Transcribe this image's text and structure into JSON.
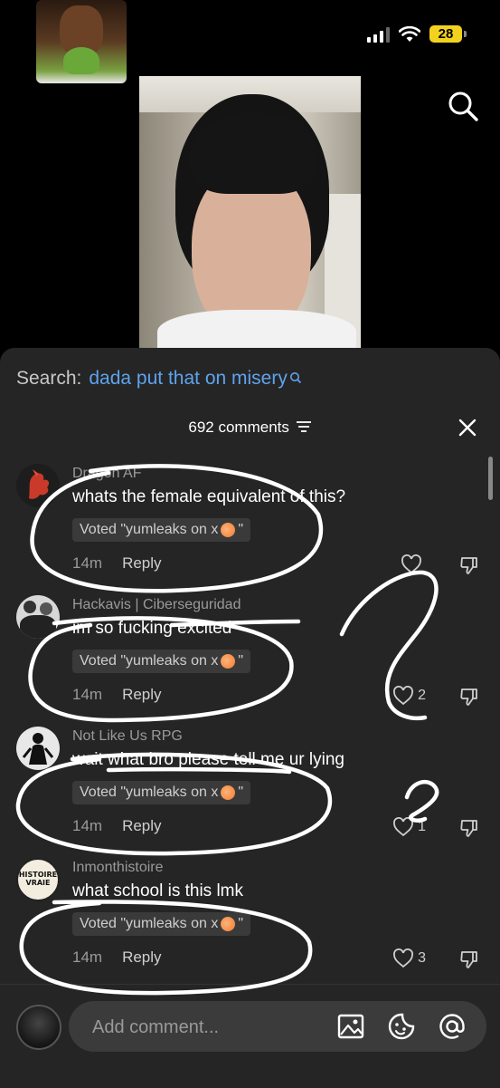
{
  "status_bar": {
    "battery": "28"
  },
  "sheet": {
    "search_label": "Search:",
    "search_query": "dada put that on misery",
    "comment_count": "692 comments"
  },
  "comments": [
    {
      "user": "Dragon AF",
      "text": "whats the female equivalent of this?",
      "vote_prefix": "Voted \"yumleaks on x",
      "vote_suffix": "\"",
      "time": "14m",
      "reply": "Reply",
      "likes": ""
    },
    {
      "user": "Hackavis | Ciberseguridad",
      "text": "im so fucking excited",
      "vote_prefix": "Voted \"yumleaks on x",
      "vote_suffix": "\"",
      "time": "14m",
      "reply": "Reply",
      "likes": "2"
    },
    {
      "user": "Not Like Us RPG",
      "text": "wait what bro please tell me ur lying",
      "vote_prefix": "Voted \"yumleaks on x",
      "vote_suffix": "\"",
      "time": "14m",
      "reply": "Reply",
      "likes": "1"
    },
    {
      "user": "Inmonthistoire",
      "text": "what school is this lmk",
      "vote_prefix": "Voted \"yumleaks on x",
      "vote_suffix": "\"",
      "time": "14m",
      "reply": "Reply",
      "likes": "3"
    }
  ],
  "avatar_4_text": {
    "line1": "HISTOIRE",
    "line2": "VRAIE"
  },
  "composer": {
    "placeholder": "Add comment..."
  },
  "colors": {
    "accent": "#5ea3ef",
    "sheet_bg": "#252525",
    "battery": "#f2d21f"
  }
}
